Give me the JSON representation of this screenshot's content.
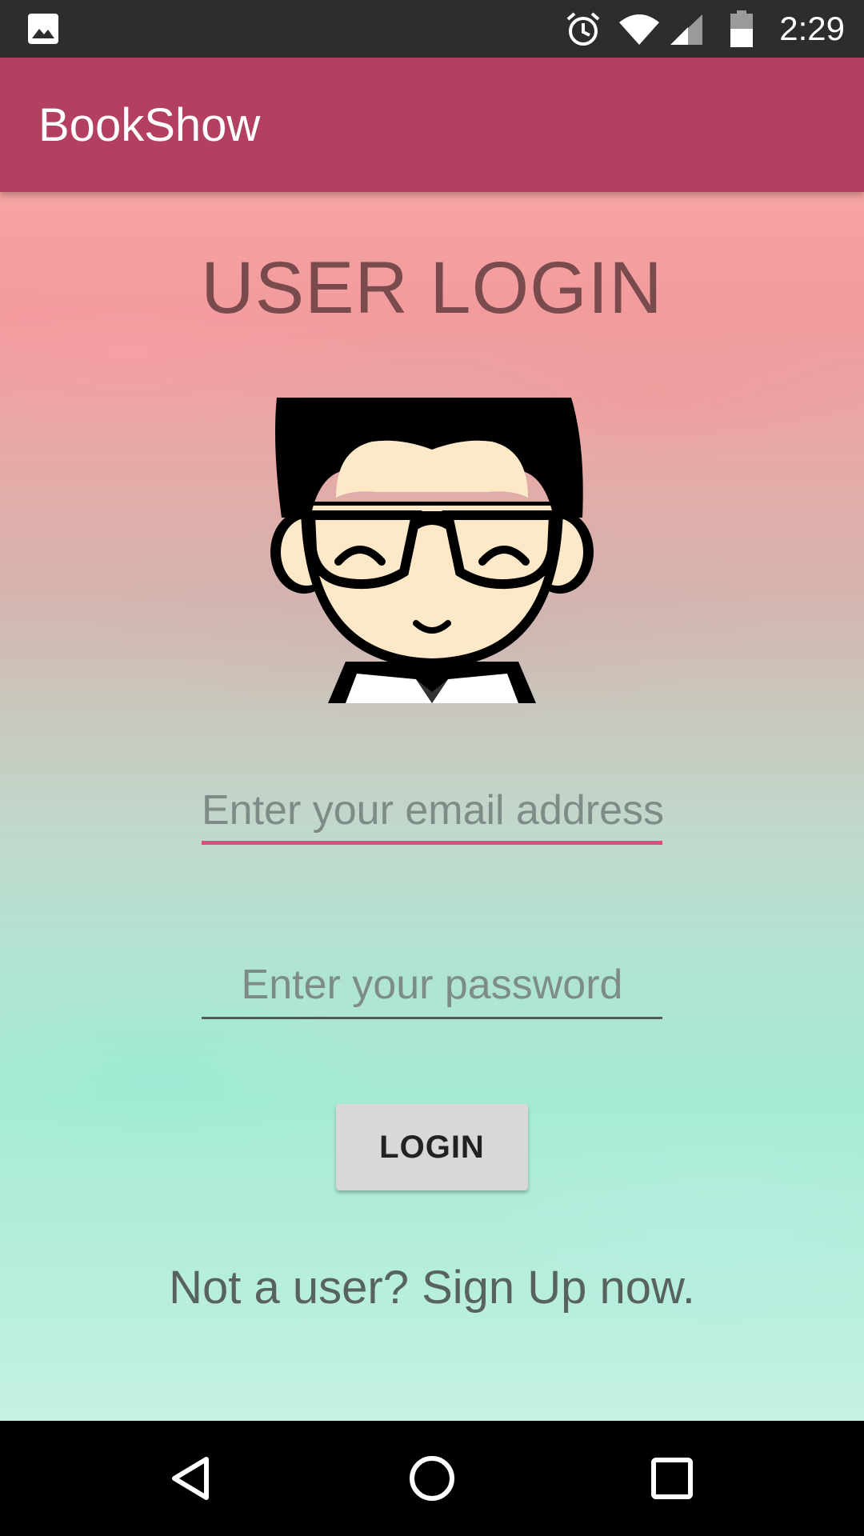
{
  "status_bar": {
    "time": "2:29",
    "icons": [
      "image-icon",
      "alarm-icon",
      "wifi-icon",
      "signal-icon",
      "battery-icon"
    ]
  },
  "app_bar": {
    "title": "BookShow",
    "color": "#b33f61"
  },
  "main": {
    "heading": "USER LOGIN",
    "avatar_icon": "cartoon-avatar-with-glasses",
    "email_placeholder": "Enter your email address",
    "email_value": "",
    "password_placeholder": "Enter your password",
    "password_value": "",
    "login_button": "LOGIN",
    "signup_link": "Not a user? Sign Up now.",
    "accent_color": "#e8477e"
  },
  "nav_bar": {
    "icons": [
      "back-icon",
      "home-icon",
      "recents-icon"
    ]
  }
}
